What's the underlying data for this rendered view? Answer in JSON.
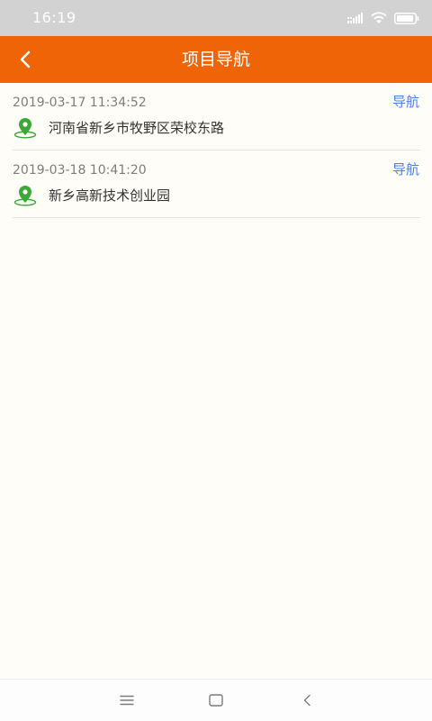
{
  "status_bar": {
    "time": "16:19",
    "icons": [
      "signal-icon",
      "wifi-icon",
      "battery-icon"
    ]
  },
  "header": {
    "title": "项目导航",
    "back_icon": "back-arrow-icon"
  },
  "records": [
    {
      "datetime": "2019-03-17 11:34:52",
      "address": "河南省新乡市牧野区荣校东路",
      "nav_label": "导航"
    },
    {
      "datetime": "2019-03-18 10:41:20",
      "address": "新乡高新技术创业园",
      "nav_label": "导航"
    }
  ],
  "system_nav": [
    "menu-icon",
    "home-icon",
    "back-icon"
  ],
  "colors": {
    "app_bar": "#ef6407",
    "status_bar": "#d2d2d2",
    "page_background": "#fffdf8",
    "link": "#4a7fe8",
    "location_icon": "#3ba935"
  }
}
